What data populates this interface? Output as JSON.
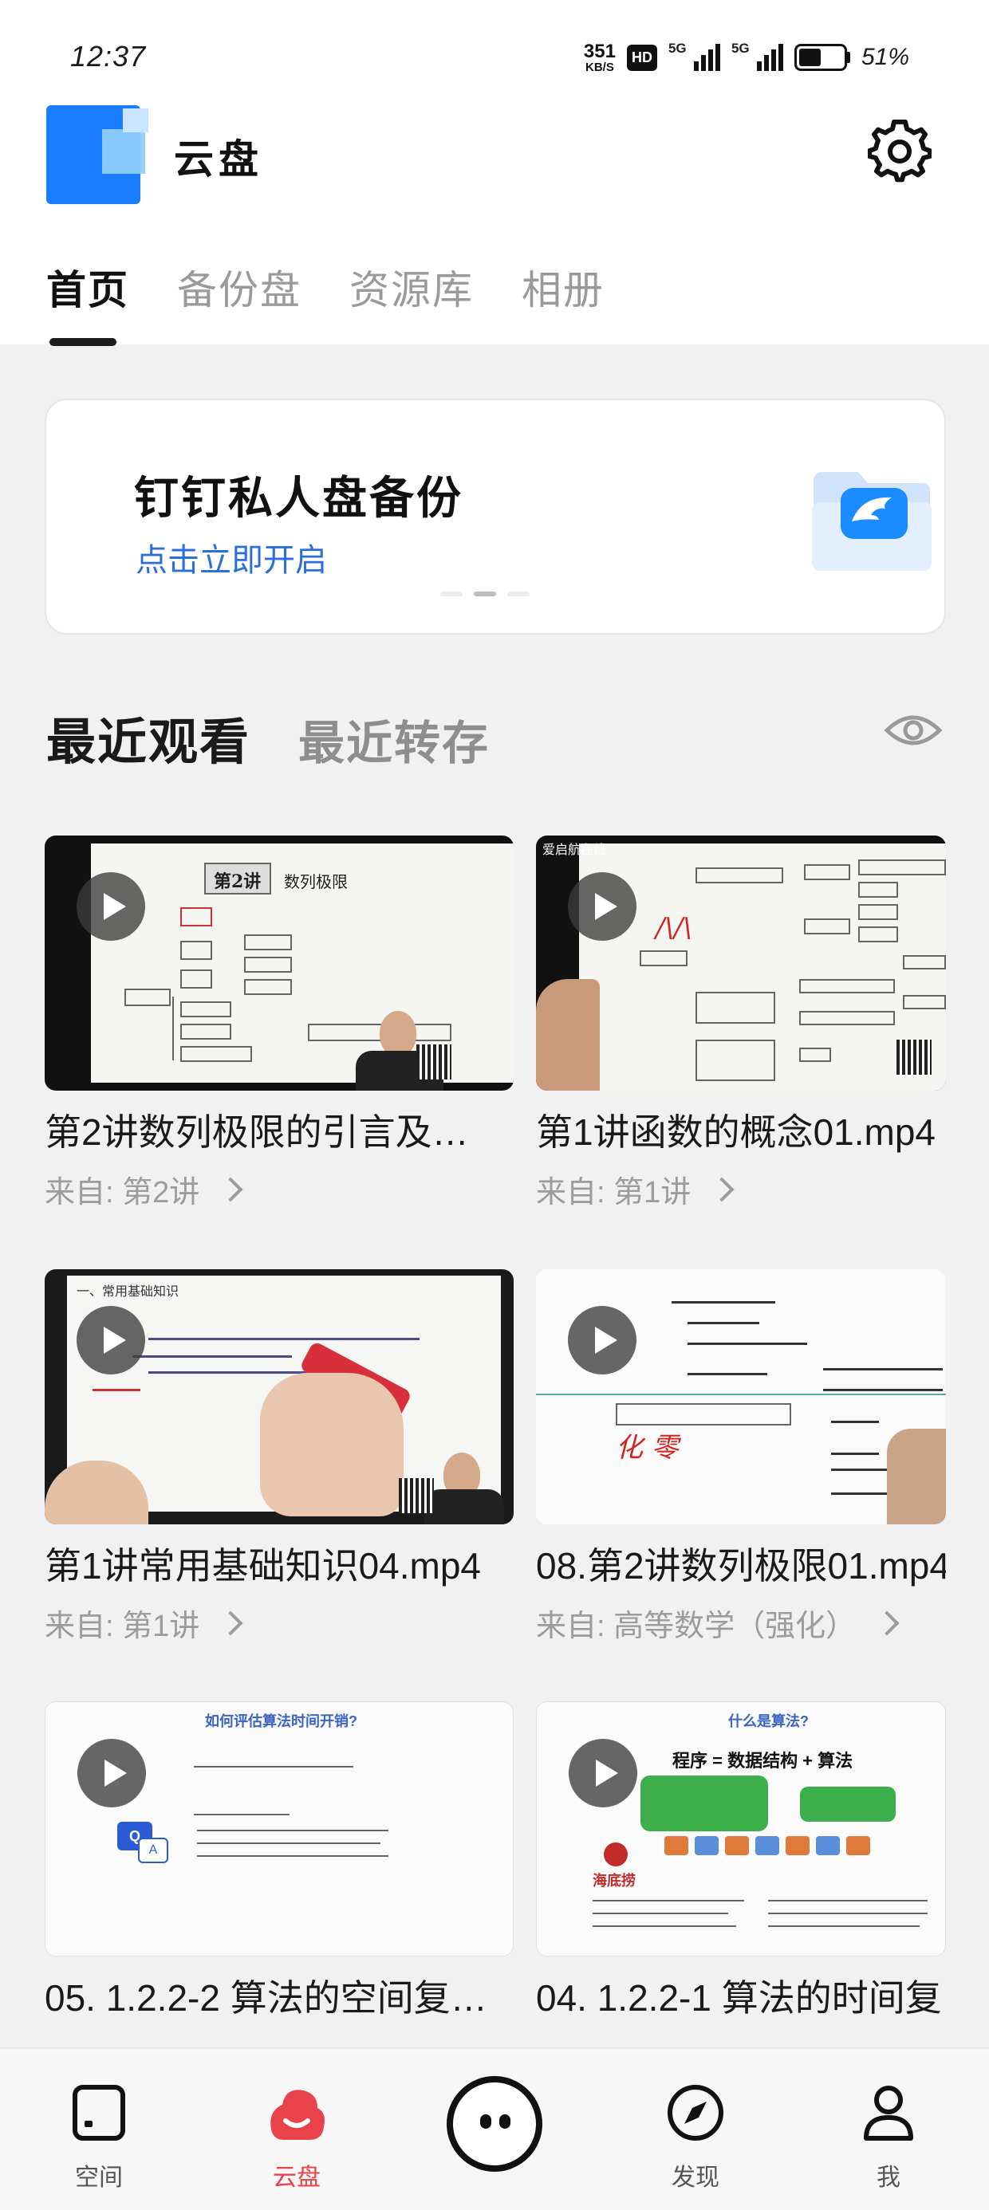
{
  "status_bar": {
    "time": "12:37",
    "net_speed": "351",
    "net_speed_unit": "KB/S",
    "hd_badge": "HD",
    "signal1_label": "5G",
    "signal2_label": "5G",
    "battery_level": 0.51,
    "battery_pct": "51%"
  },
  "header": {
    "app_title": "云盘",
    "settings_icon": "gear-icon"
  },
  "top_tabs": [
    {
      "label": "首页",
      "active": true
    },
    {
      "label": "备份盘",
      "active": false
    },
    {
      "label": "资源库",
      "active": false
    },
    {
      "label": "相册",
      "active": false
    }
  ],
  "banner": {
    "title": "钉钉私人盘备份",
    "link": "点击立即开启",
    "icon": "folder-wing-icon"
  },
  "recent": {
    "tabs": [
      {
        "label": "最近观看",
        "active": true
      },
      {
        "label": "最近转存",
        "active": false
      }
    ],
    "visibility_icon": "eye-icon",
    "items": [
      {
        "title": "第2讲数列极限的引言及…",
        "source": "来自: 第2讲"
      },
      {
        "title": "第1讲函数的概念01.mp4",
        "source": "来自: 第1讲"
      },
      {
        "title": "第1讲常用基础知识04.mp4",
        "source": "来自: 第1讲"
      },
      {
        "title": "08.第2讲数列极限01.mp4",
        "source": "来自: 高等数学（强化）"
      },
      {
        "title": "05. 1.2.2-2 算法的空间复…",
        "source": ""
      },
      {
        "title": "04. 1.2.2-1 算法的时间复",
        "source": ""
      }
    ],
    "thumb_text": {
      "t1_heading": "第2讲",
      "t1_sub": "数列极限",
      "t2_brand": "爱启航在线",
      "t3_heading": "一、常用基础知识",
      "t4_red": "化 零",
      "t5_heading": "如何评估算法时间开销?",
      "t6_heading": "什么是算法?",
      "t6_formula": "程序 = 数据结构 + 算法",
      "t6_logo": "海底捞"
    }
  },
  "bottom_nav": [
    {
      "label": "空间",
      "icon": "space-icon",
      "active": false
    },
    {
      "label": "云盘",
      "icon": "cloud-drive-icon",
      "active": true
    },
    {
      "label": "发现",
      "icon": "compass-icon",
      "active": false
    },
    {
      "label": "我",
      "icon": "person-icon",
      "active": false
    }
  ],
  "center_button_icon": "chat-face-icon",
  "colors": {
    "accent_blue": "#2d6fd8",
    "logo_blue": "#1a7cff",
    "active_nav_red": "#e8434a"
  }
}
